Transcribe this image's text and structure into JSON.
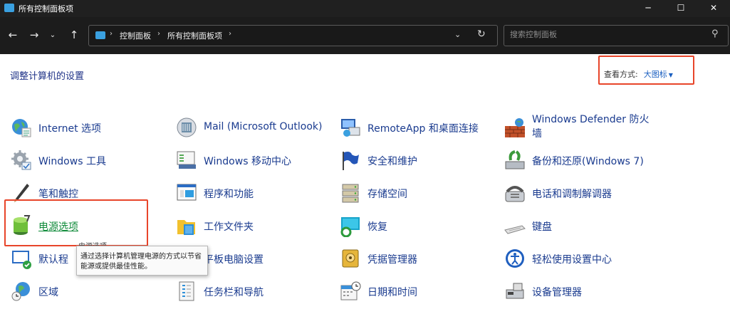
{
  "window": {
    "title": "所有控制面板项",
    "min_glyph": "─",
    "max_glyph": "☐",
    "close_glyph": "✕"
  },
  "nav": {
    "back_glyph": "←",
    "forward_glyph": "→",
    "recent_glyph": "⌄",
    "up_glyph": "↑"
  },
  "address": {
    "crumb_sep": "›",
    "crumbs": [
      "控制面板",
      "所有控制面板项"
    ],
    "trailing_sep": "›",
    "dropdown_glyph": "⌄",
    "refresh_glyph": "↻"
  },
  "search": {
    "placeholder": "搜索控制面板",
    "icon_glyph": "⚲"
  },
  "content": {
    "heading": "调整计算机的设置",
    "view_label": "查看方式:",
    "view_value": "大图标",
    "view_caret": "▼"
  },
  "items": {
    "internet_options": "Internet 选项",
    "mail": "Mail (Microsoft Outlook)",
    "remoteapp": "RemoteApp 和桌面连接",
    "windows_defender": "Windows Defender 防火墙",
    "windows_tools": "Windows 工具",
    "windows_mobility": "Windows 移动中心",
    "security_maintenance": "安全和维护",
    "backup_restore": "备份和还原(Windows 7)",
    "pen_touch": "笔和触控",
    "programs_features": "程序和功能",
    "storage_spaces": "存储空间",
    "phone_modem": "电话和调制解调器",
    "power_options": "电源选项",
    "work_folders": "工作文件夹",
    "recovery": "恢复",
    "keyboard": "键盘",
    "default_programs": "默认程",
    "tablet_settings": "平板电脑设置",
    "credential_manager": "凭据管理器",
    "ease_of_access": "轻松使用设置中心",
    "region": "区域",
    "taskbar_nav": "任务栏和导航",
    "date_time": "日期和时间",
    "device_manager": "设备管理器"
  },
  "tooltip": {
    "title": "电源选项",
    "text": "通过选择计算机管理电源的方式以节省能源或提供最佳性能。"
  },
  "colors": {
    "highlight": "#e8452a",
    "link": "#1a3b8f",
    "hover_link": "#0d8a38"
  }
}
